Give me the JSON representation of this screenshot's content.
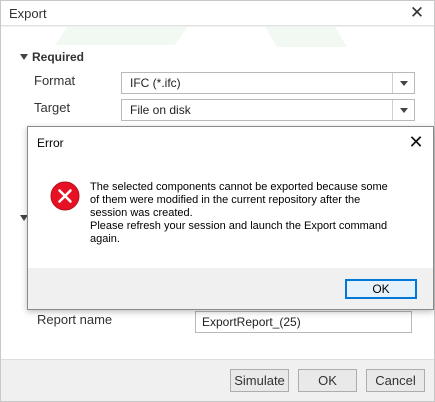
{
  "export_dialog": {
    "title": "Export",
    "close_glyph": "✕",
    "section_required": "Required",
    "format_label": "Format",
    "format_value": "IFC (*.ifc)",
    "target_label": "Target",
    "target_value": "File on disk",
    "report_name_label": "Report name",
    "report_name_value": "ExportReport_(25)",
    "buttons": {
      "simulate": "Simulate",
      "ok": "OK",
      "cancel": "Cancel"
    }
  },
  "error_dialog": {
    "title": "Error",
    "close_glyph": "✕",
    "message_lines": [
      "The selected components cannot be exported because some",
      "of them were modified in the current repository after the",
      "session was created.",
      "Please refresh your session and launch the Export command",
      "again."
    ],
    "ok_label": "OK",
    "icon": "error-x-circle-icon",
    "icon_color": "#e81123"
  }
}
